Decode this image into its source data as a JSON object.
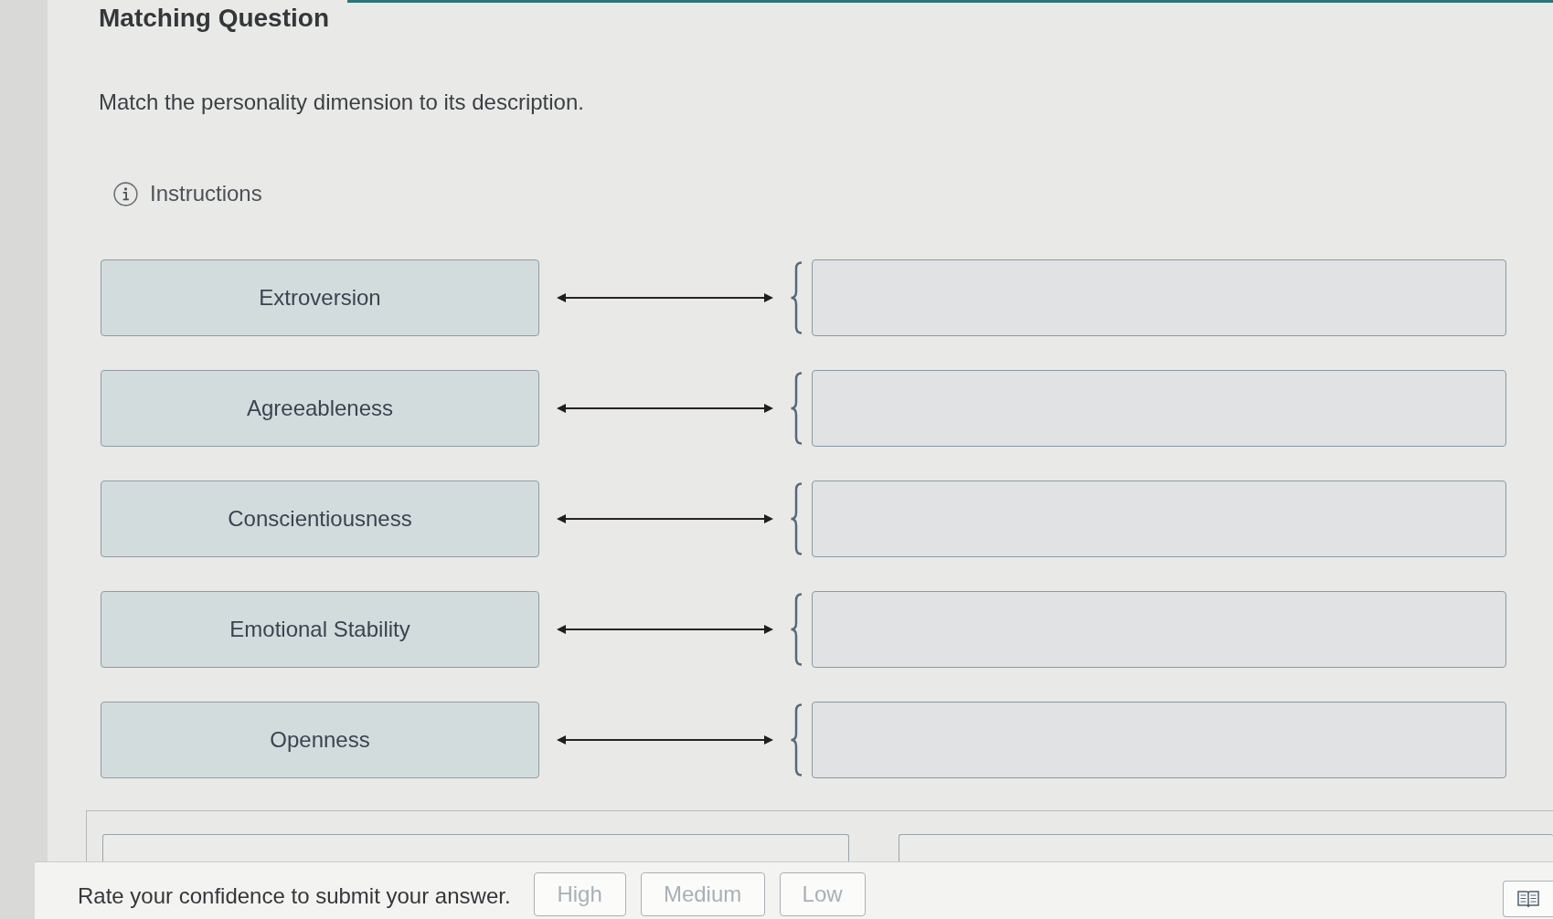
{
  "title": "Matching Question",
  "prompt": "Match the personality dimension to its description.",
  "instructions": {
    "label": "Instructions"
  },
  "pairs": [
    {
      "term": "Extroversion"
    },
    {
      "term": "Agreeableness"
    },
    {
      "term": "Conscientiousness"
    },
    {
      "term": "Emotional Stability"
    },
    {
      "term": "Openness"
    }
  ],
  "confidence": {
    "prompt": "Rate your confidence to submit your answer.",
    "buttons": [
      {
        "label": "High",
        "disabled": true
      },
      {
        "label": "Medium",
        "disabled": true
      },
      {
        "label": "Low",
        "disabled": true
      }
    ]
  }
}
